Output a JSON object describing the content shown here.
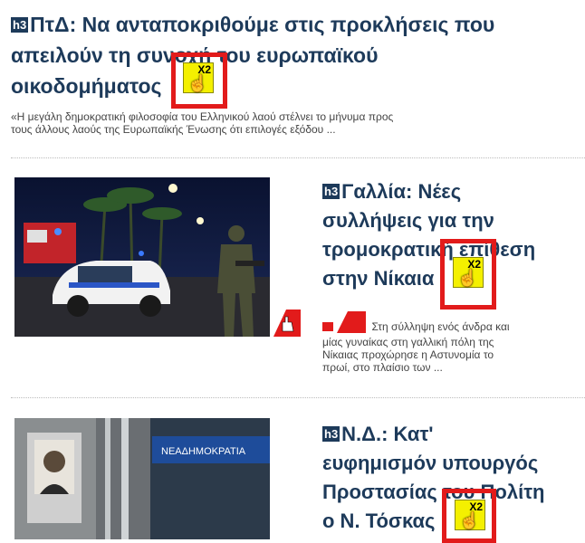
{
  "tags": {
    "h3": "h3"
  },
  "x2_label": "X2",
  "articles": [
    {
      "title_line1": "ΠτΔ: Να ανταποκριθούμε στις προκλήσεις που",
      "title_line2": "απειλούν τη συνοχή του ευρωπαϊκού",
      "title_line3": "οικοδομήματος",
      "excerpt_line1": "«Η μεγάλη δημοκρατική φιλοσοφία του Ελληνικού λαού στέλνει το μήνυμα προς",
      "excerpt_line2": "τους άλλους λαούς της Ευρωπαϊκής Ένωσης ότι επιλογές εξόδου ..."
    },
    {
      "title_lines": [
        "Γαλλία: Νέες",
        "συλλήψεις για την",
        "τρομοκρατική επίθεση",
        "στην Νίκαια"
      ],
      "excerpt_lines": [
        "Στη σύλληψη ενός άνδρα και",
        "μίας γυναίκας στη γαλλική πόλη της",
        "Νίκαιας προχώρησε η Αστυνομία το",
        "πρωί, στο πλαίσιο των ..."
      ],
      "image_label": "POLICE"
    },
    {
      "title_lines": [
        "Ν.Δ.: Κατ'",
        "ευφημισμόν υπουργός",
        "Προστασίας του Πολίτη",
        "ο Ν. Τόσκας"
      ],
      "image_sign": "ΝΕΑΔΗΜΟΚΡΑΤΙΑ"
    }
  ],
  "colors": {
    "title": "#1d3a5a",
    "highlight_box": "#e21b1b",
    "x2_badge": "#f4f000"
  }
}
